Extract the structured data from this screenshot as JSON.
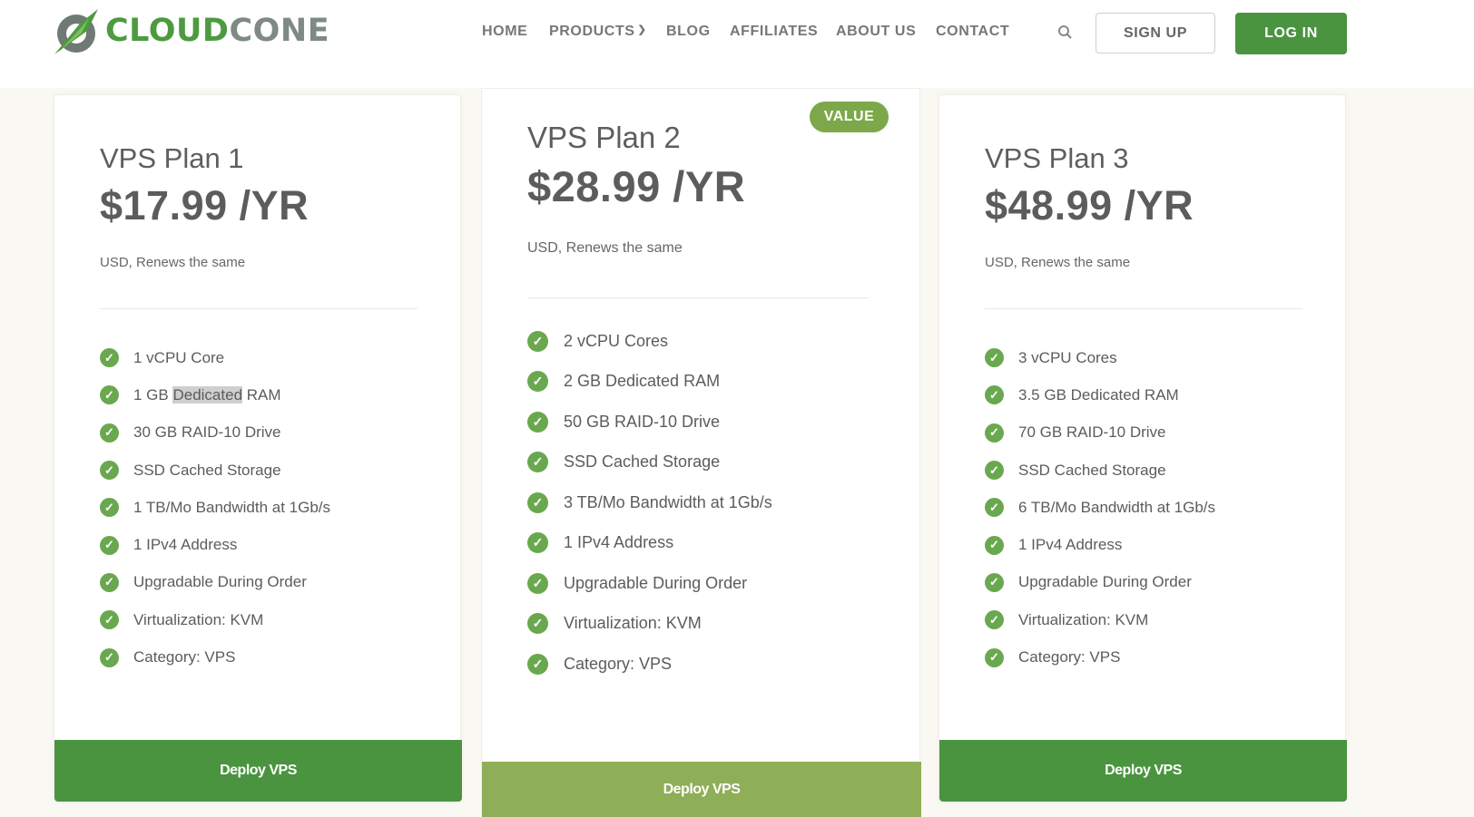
{
  "brand": {
    "name_part1": "CLOUD",
    "name_part2": "CONE",
    "green": "#4d9a3f",
    "gray": "#7f8a84"
  },
  "nav": {
    "items": [
      "HOME",
      "PRODUCTS",
      "BLOG",
      "AFFILIATES",
      "ABOUT US",
      "CONTACT"
    ],
    "products_chevron": "chevron-down-icon",
    "search_icon": "search-icon",
    "signup_label": "SIGN UP",
    "login_label": "LOG IN"
  },
  "colors": {
    "accent_green": "#4a9440",
    "check_green": "#6aa84f",
    "value_badge": "#7ca84a",
    "featured_deploy": "#8fae58"
  },
  "plans": [
    {
      "name": "VPS Plan 1",
      "price": "$17.99 /YR",
      "note": "USD, Renews the same",
      "features": [
        "1 vCPU Core",
        "1 GB Dedicated RAM",
        "30 GB RAID-10 Drive",
        "SSD Cached Storage",
        "1 TB/Mo Bandwidth at 1Gb/s",
        "1 IPv4 Address",
        "Upgradable During Order",
        "Virtualization: KVM",
        "Category: VPS"
      ],
      "feature1_parts": [
        "1 GB ",
        "Dedicated",
        " RAM"
      ],
      "deploy_label": "Deploy VPS"
    },
    {
      "name": "VPS Plan 2",
      "price": "$28.99 /YR",
      "note": "USD, Renews the same",
      "badge": "VALUE",
      "features": [
        "2 vCPU Cores",
        "2 GB Dedicated RAM",
        "50 GB RAID-10 Drive",
        "SSD Cached Storage",
        "3 TB/Mo Bandwidth at 1Gb/s",
        "1 IPv4 Address",
        "Upgradable During Order",
        "Virtualization: KVM",
        "Category: VPS"
      ],
      "deploy_label": "Deploy VPS"
    },
    {
      "name": "VPS Plan 3",
      "price": "$48.99 /YR",
      "note": "USD, Renews the same",
      "features": [
        "3 vCPU Cores",
        "3.5 GB Dedicated RAM",
        "70 GB RAID-10 Drive",
        "SSD Cached Storage",
        "6 TB/Mo Bandwidth at 1Gb/s",
        "1 IPv4 Address",
        "Upgradable During Order",
        "Virtualization: KVM",
        "Category: VPS"
      ],
      "deploy_label": "Deploy VPS"
    }
  ]
}
